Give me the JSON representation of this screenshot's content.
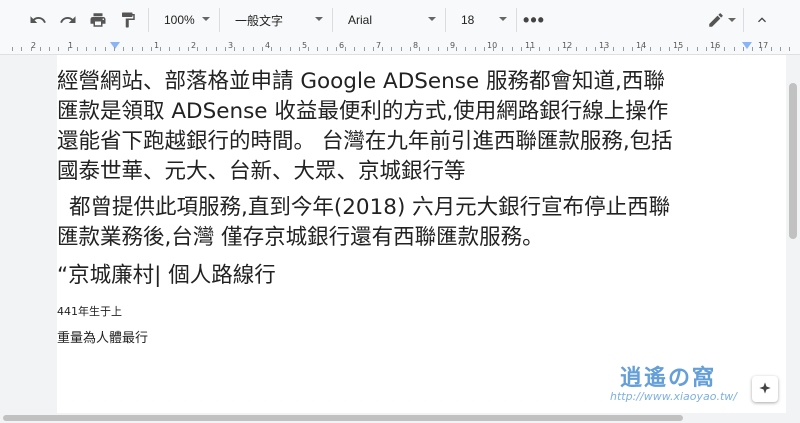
{
  "toolbar": {
    "undo_icon": "undo-icon",
    "redo_icon": "redo-icon",
    "print_icon": "print-icon",
    "paint_format_icon": "paint-format-icon",
    "zoom": "100%",
    "style": "一般文字",
    "font": "Arial",
    "font_size": "18",
    "more": "•••",
    "edit_mode_icon": "pencil-icon",
    "collapse_icon": "chevron-up-icon"
  },
  "ruler": {
    "numbers": [
      "2",
      "1",
      "",
      "1",
      "2",
      "3",
      "4",
      "5",
      "6",
      "7",
      "8",
      "9",
      "10",
      "11",
      "12",
      "13",
      "14",
      "15",
      "16",
      "17"
    ]
  },
  "document": {
    "paragraph1": "經營網站、部落格並申請 Google ADSense 服務都會知道,西聯匯款是領取 ADSense 收益最便利的方式,使用網路銀行線上操作還能省下跑越銀行的時間。 台灣在九年前引進西聯匯款服務,包括國泰世華、元大、台新、大眾、京城銀行等",
    "paragraph2": "都曾提供此項服務,直到今年(2018) 六月元大銀行宣布停止西聯匯款業務後,台灣 僅存京城銀行還有西聯匯款服務。",
    "quote_line": "“京城廉村| 個人路線行",
    "small_line1": "441年生于上",
    "small_line2": "重量為人體最行"
  },
  "watermark": {
    "logo_text": "逍遙の窩",
    "url": "http://www.xiaoyao.tw/"
  },
  "colors": {
    "toolbar_bg": "#f8f9fa",
    "ruler_marker": "#8ab4f8",
    "page_bg": "#ffffff",
    "text": "#222222"
  }
}
